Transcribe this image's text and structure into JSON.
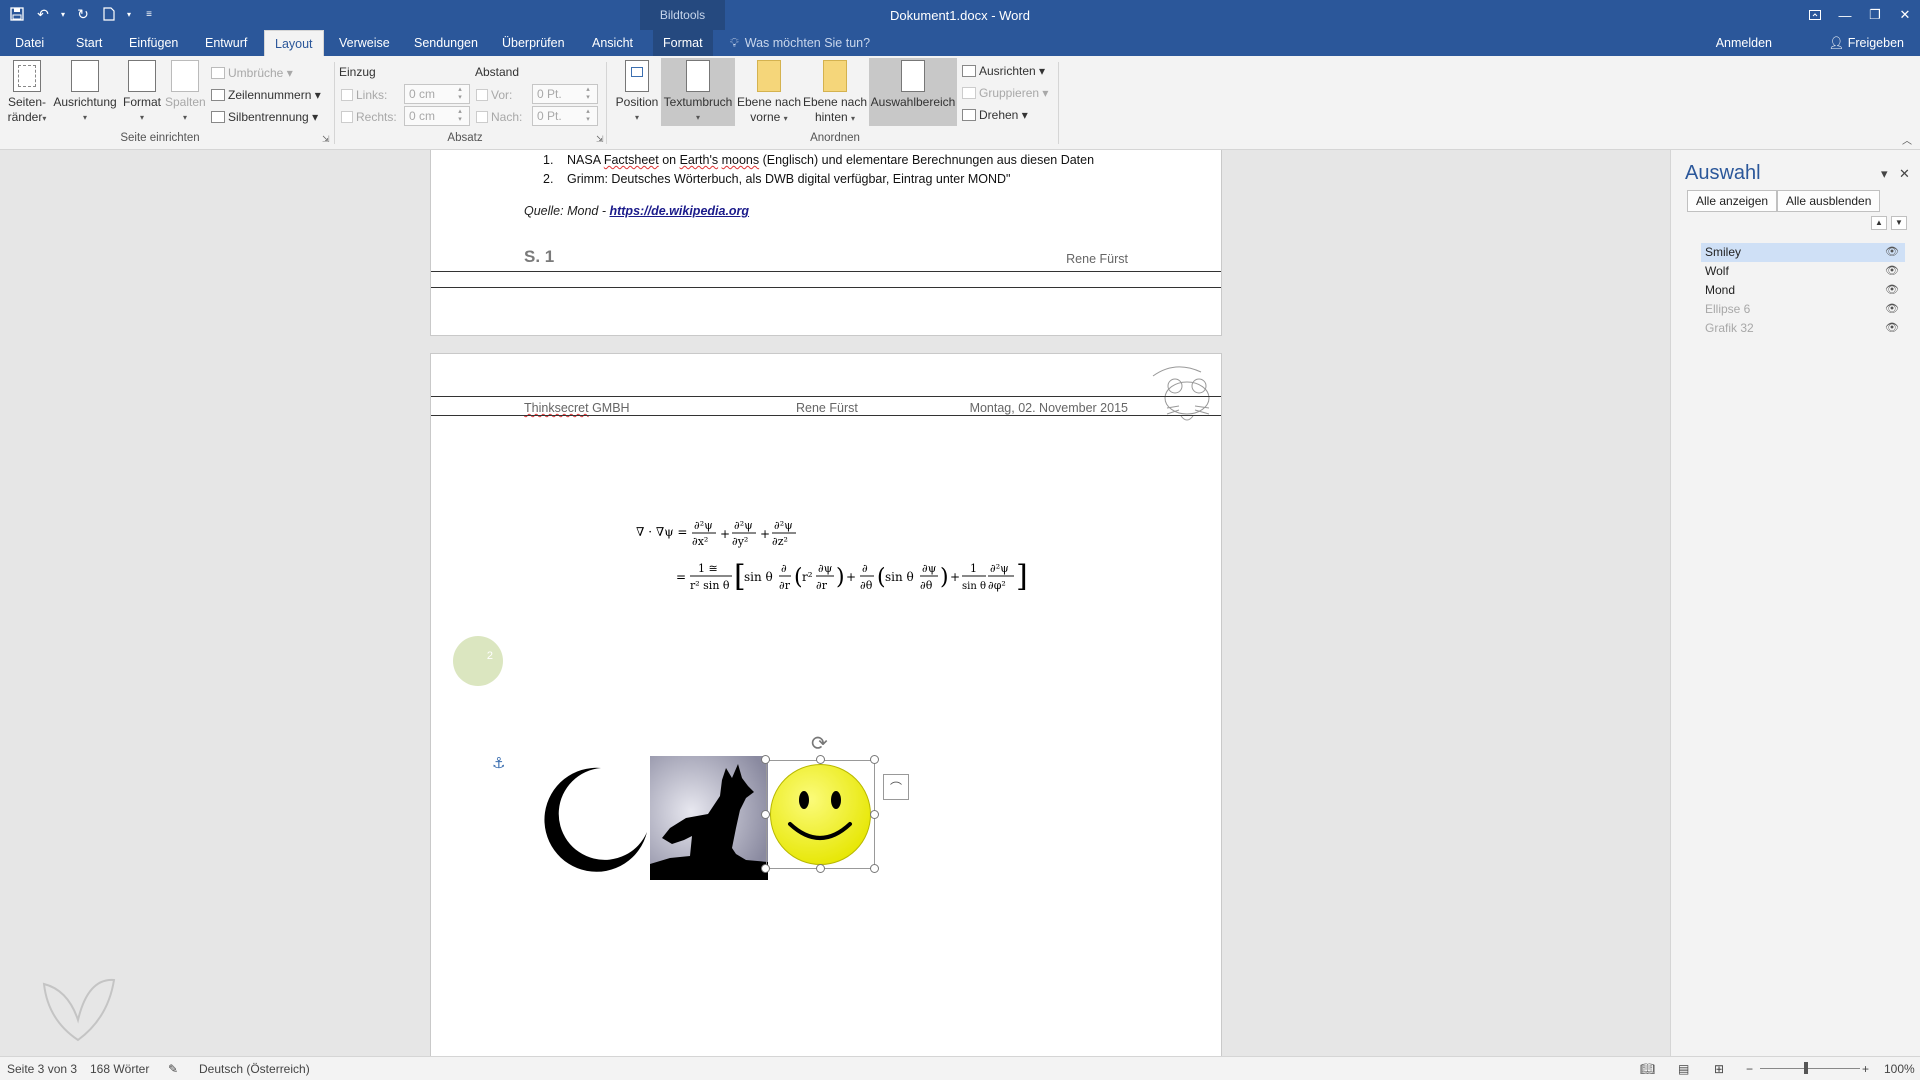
{
  "titlebar": {
    "document_title": "Dokument1.docx - Word",
    "context_tab_group": "Bildtools"
  },
  "tabs": [
    "Datei",
    "Start",
    "Einfügen",
    "Entwurf",
    "Layout",
    "Verweise",
    "Sendungen",
    "Überprüfen",
    "Ansicht",
    "Format"
  ],
  "active_tab": "Layout",
  "tell_me_placeholder": "Was möchten Sie tun?",
  "account": {
    "sign_in": "Anmelden",
    "share": "Freigeben"
  },
  "ribbon": {
    "seite_einrichten": {
      "label": "Seite einrichten",
      "seitenraender_1": "Seiten-",
      "seitenraender_2": "ränder",
      "ausrichtung": "Ausrichtung",
      "format": "Format",
      "spalten": "Spalten",
      "umbrueche": "Umbrüche",
      "zeilennummern": "Zeilennummern",
      "silbentrennung": "Silbentrennung"
    },
    "absatz": {
      "label": "Absatz",
      "einzug": "Einzug",
      "abstand": "Abstand",
      "links": "Links:",
      "rechts": "Rechts:",
      "vor": "Vor:",
      "nach": "Nach:",
      "links_value": "0 cm",
      "rechts_value": "0 cm",
      "vor_value": "0 Pt.",
      "nach_value": "0 Pt."
    },
    "anordnen": {
      "label": "Anordnen",
      "position": "Position",
      "textumbruch": "Textumbruch",
      "ebene_vorne_1": "Ebene nach",
      "ebene_vorne_2": "vorne",
      "ebene_hinten_1": "Ebene nach",
      "ebene_hinten_2": "hinten",
      "auswahlbereich": "Auswahlbereich",
      "ausrichten": "Ausrichten",
      "gruppieren": "Gruppieren",
      "drehen": "Drehen"
    }
  },
  "document": {
    "page1": {
      "list": [
        {
          "num": "1.",
          "pre": "NASA ",
          "sq1": "Factsheet",
          "mid1": " on ",
          "sq2": "Earth's",
          "mid2": " ",
          "sq3": "moons",
          "post": " (Englisch) und elementare Berechnungen aus diesen Daten"
        },
        {
          "num": "2.",
          "text": "Grimm: Deutsches Wörterbuch, als DWB digital verfügbar, Eintrag unter MOND\""
        }
      ],
      "quelle_label": "Quelle: Mond - ",
      "quelle_link": "https://de.wikipedia.org",
      "footer_page": "S. 1",
      "footer_name": "Rene Fürst"
    },
    "page2": {
      "header_company_sq": "Thinksecret",
      "header_company_rest": " GMBH",
      "header_name": "Rene Fürst",
      "header_date": "Montag, 02. November 2015",
      "ellipse_label": "2"
    }
  },
  "selection_pane": {
    "title": "Auswahl",
    "show_all": "Alle anzeigen",
    "hide_all": "Alle ausblenden",
    "items": [
      {
        "name": "Smiley",
        "selected": true,
        "dim": false
      },
      {
        "name": "Wolf",
        "selected": false,
        "dim": false
      },
      {
        "name": "Mond",
        "selected": false,
        "dim": false
      },
      {
        "name": "Ellipse 6",
        "selected": false,
        "dim": true
      },
      {
        "name": "Grafik 32",
        "selected": false,
        "dim": true
      }
    ]
  },
  "statusbar": {
    "page": "Seite 3 von 3",
    "words": "168 Wörter",
    "language": "Deutsch (Österreich)",
    "zoom": "100%"
  },
  "colors": {
    "accent": "#2b579a",
    "smiley_yellow": "#f4f416",
    "selection_highlight": "#cfe0f6"
  }
}
